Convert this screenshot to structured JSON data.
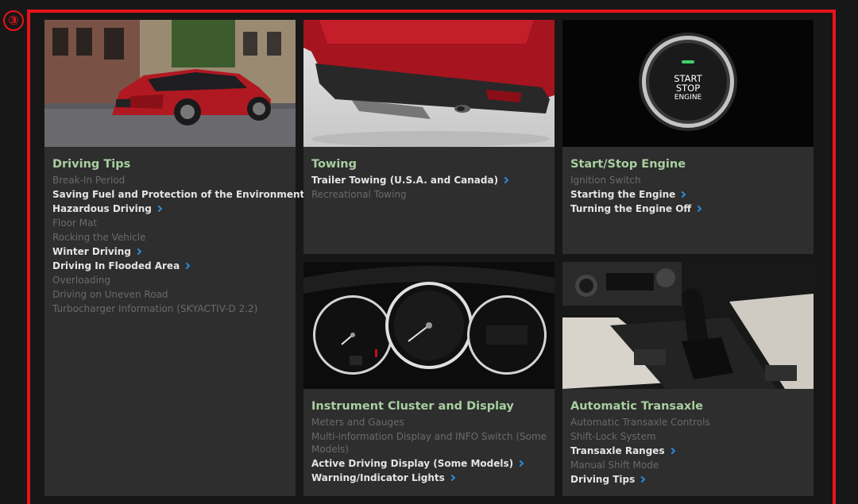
{
  "marker": "③",
  "cards": [
    {
      "title": "Driving Tips",
      "items": [
        {
          "label": "Break-In Period",
          "link": false
        },
        {
          "label": "Saving Fuel and Protection of the Environment",
          "link": true
        },
        {
          "label": "Hazardous Driving",
          "link": true
        },
        {
          "label": "Floor Mat",
          "link": false
        },
        {
          "label": "Rocking the Vehicle",
          "link": false
        },
        {
          "label": "Winter Driving",
          "link": true
        },
        {
          "label": "Driving In Flooded Area",
          "link": true
        },
        {
          "label": "Overloading",
          "link": false
        },
        {
          "label": "Driving on Uneven Road",
          "link": false
        },
        {
          "label": "Turbocharger Information (SKYACTIV-D 2.2)",
          "link": false
        }
      ]
    },
    {
      "title": "Towing",
      "items": [
        {
          "label": "Trailer Towing (U.S.A. and Canada)",
          "link": true
        },
        {
          "label": "Recreational Towing",
          "link": false
        }
      ]
    },
    {
      "title": "Start/Stop Engine",
      "button_text": [
        "START",
        "STOP",
        "ENGINE"
      ],
      "items": [
        {
          "label": "Ignition Switch",
          "link": false
        },
        {
          "label": "Starting the Engine",
          "link": true
        },
        {
          "label": "Turning the Engine Off",
          "link": true
        }
      ]
    },
    {
      "title": "Instrument Cluster and Display",
      "items": [
        {
          "label": "Meters and Gauges",
          "link": false
        },
        {
          "label": "Multi-information Display and INFO Switch (Some Models)",
          "link": false
        },
        {
          "label": "Active Driving Display (Some Models)",
          "link": true
        },
        {
          "label": "Warning/Indicator Lights",
          "link": true
        }
      ]
    },
    {
      "title": "Automatic Transaxle",
      "items": [
        {
          "label": "Automatic Transaxle Controls",
          "link": false
        },
        {
          "label": "Shift-Lock System",
          "link": false
        },
        {
          "label": "Transaxle Ranges",
          "link": true
        },
        {
          "label": "Manual Shift Mode",
          "link": false
        },
        {
          "label": "Driving Tips",
          "link": true
        }
      ]
    }
  ],
  "colors": {
    "background": "#171717",
    "card": "#2e2e2e",
    "title": "#a8cfa0",
    "link": "#e4e4e4",
    "dim": "#6a6a6a",
    "chevron": "#2a8cdc",
    "highlight": "#e8141b"
  }
}
